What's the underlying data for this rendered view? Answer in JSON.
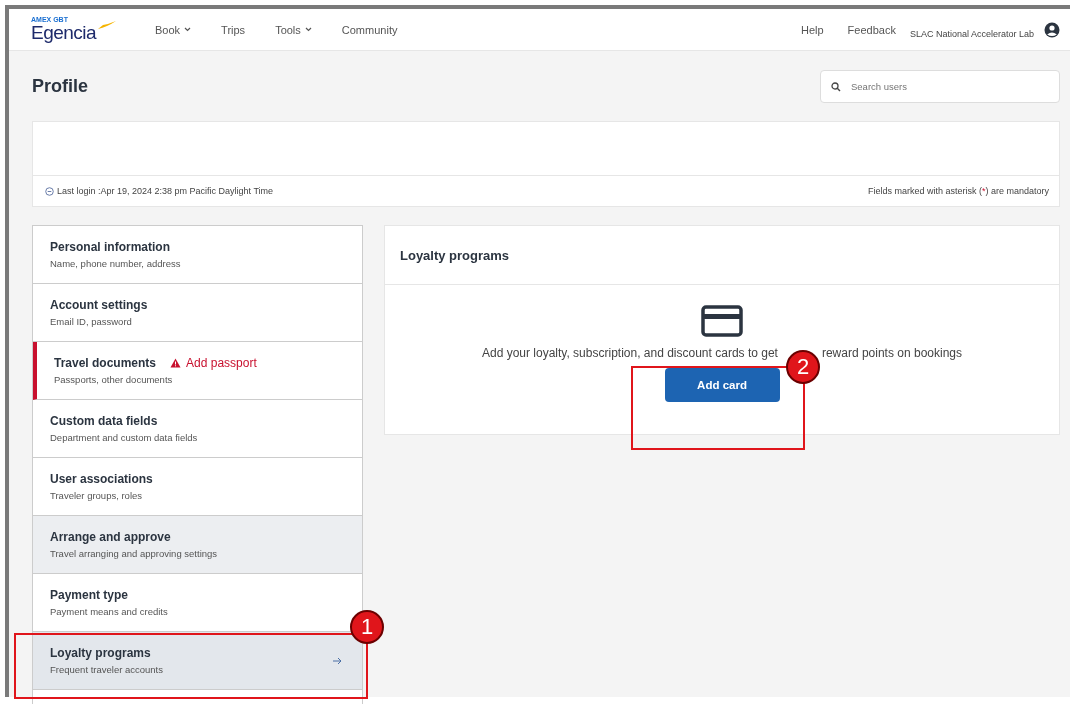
{
  "header": {
    "logo_tag": "AMEX GBT",
    "logo": "Egencia",
    "nav": [
      {
        "label": "Book",
        "dropdown": true
      },
      {
        "label": "Trips",
        "dropdown": false
      },
      {
        "label": "Tools",
        "dropdown": true
      },
      {
        "label": "Community",
        "dropdown": false
      }
    ],
    "links": [
      "Help",
      "Feedback"
    ],
    "account": "SLAC National Accelerator Lab"
  },
  "page": {
    "title": "Profile",
    "search": {
      "placeholder": "Search users"
    },
    "last_login": "Last login :Apr 19, 2024 2:38 pm Pacific Daylight Time",
    "mandatory_note": "Fields marked with asterisk (*) are mandatory"
  },
  "sidebar": {
    "items": [
      {
        "title": "Personal information",
        "subtitle": "Name, phone number, address",
        "selected": false,
        "highlighted": false
      },
      {
        "title": "Account settings",
        "subtitle": "Email ID, password",
        "selected": false,
        "highlighted": false
      },
      {
        "title": "Travel documents",
        "subtitle": "Passports, other documents",
        "alert": "Add passport",
        "selected": false,
        "highlighted": false
      },
      {
        "title": "Custom data fields",
        "subtitle": "Department and custom data fields",
        "selected": false,
        "highlighted": false
      },
      {
        "title": "User associations",
        "subtitle": "Traveler groups, roles",
        "selected": false,
        "highlighted": false
      },
      {
        "title": "Arrange and approve",
        "subtitle": "Travel arranging and approving settings",
        "selected": false,
        "highlighted": true
      },
      {
        "title": "Payment type",
        "subtitle": "Payment means and credits",
        "selected": false,
        "highlighted": false
      },
      {
        "title": "Loyalty programs",
        "subtitle": "Frequent traveler accounts",
        "selected": true,
        "highlighted": true
      }
    ]
  },
  "panel": {
    "title": "Loyalty programs",
    "message": "Add your loyalty, subscription, and discount cards to get",
    "message_end": "reward points on bookings",
    "button": "Add card"
  },
  "annotations": [
    {
      "number": "1"
    },
    {
      "number": "2"
    }
  ]
}
